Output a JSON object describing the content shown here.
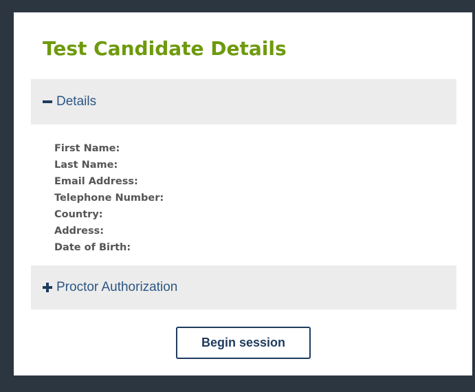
{
  "page": {
    "title": "Test Candidate Details"
  },
  "details": {
    "label": "Details",
    "expanded": true,
    "fields": [
      {
        "label": "First Name:",
        "value": ""
      },
      {
        "label": "Last Name:",
        "value": ""
      },
      {
        "label": "Email Address:",
        "value": ""
      },
      {
        "label": "Telephone Number:",
        "value": ""
      },
      {
        "label": "Country:",
        "value": ""
      },
      {
        "label": "Address:",
        "value": ""
      },
      {
        "label": "Date of Birth:",
        "value": ""
      }
    ]
  },
  "proctor": {
    "label": "Proctor Authorization",
    "expanded": false
  },
  "actions": {
    "begin_label": "Begin session"
  },
  "colors": {
    "title": "#6e9a0c",
    "header_bg": "#ececec",
    "link": "#2c5683",
    "button_border": "#1e3b5e",
    "frame": "#2b3641"
  },
  "icons": {
    "details_toggle": "minus-icon",
    "proctor_toggle": "plus-icon"
  }
}
